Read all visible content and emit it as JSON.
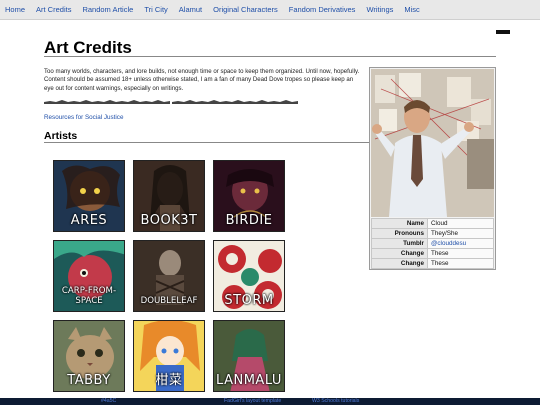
{
  "nav": {
    "items": [
      "Home",
      "Art Credits",
      "Random Article",
      "Tri City",
      "Alamut",
      "Original Characters",
      "Fandom Derivatives",
      "Writings",
      "Misc"
    ]
  },
  "page": {
    "title": "Art Credits",
    "intro": "Too many worlds, characters, and lore builds, not enough time or space to keep them organized. Until now, hopefully. Content should be assumed 18+ unless otherwise stated, I am a fan of many Dead Dove tropes so please keep an eye out for content warnings, especially on writings.",
    "resources_link": "Resources for Social Justice",
    "artists_heading": "Artists"
  },
  "artists": [
    {
      "name": "ARES",
      "bg": "#1f3550",
      "fg": "#8a5a3a"
    },
    {
      "name": "BOOK3T",
      "bg": "#3a2a22",
      "fg": "#8b6a52"
    },
    {
      "name": "BIRDIE",
      "bg": "#2a0f1c",
      "fg": "#6b2a3a"
    },
    {
      "name": "CARP-FROM-SPACE",
      "bg": "#1d5a58",
      "fg": "#c23a4a"
    },
    {
      "name": "DOUBLELEAF",
      "bg": "#3b2f26",
      "fg": "#9a8a7a"
    },
    {
      "name": "STORM",
      "bg": "#f1ece0",
      "fg": "#c32a30"
    },
    {
      "name": "TABBY",
      "bg": "#6d7a5a",
      "fg": "#b59a74"
    },
    {
      "name": "柑菜",
      "bg": "#f4d55a",
      "fg": "#e88a2a"
    },
    {
      "name": "LANMALU",
      "bg": "#4a5a3a",
      "fg": "#b54a6a"
    }
  ],
  "infobox": {
    "rows": [
      {
        "key": "Name",
        "value": "Cloud"
      },
      {
        "key": "Pronouns",
        "value": "They/She"
      },
      {
        "key": "Tumblr",
        "value": "@clouddesu"
      },
      {
        "key": "Change",
        "value": "These"
      },
      {
        "key": "Change",
        "value": "These"
      }
    ]
  },
  "footer": {
    "links": [
      "#4a5C",
      "FadGirl's layout template",
      "W3 Schools tutorials"
    ]
  },
  "colors": {
    "link": "#1f4fa8",
    "nav_bg": "#e8e8e8",
    "footer_bg": "#0d1b33"
  }
}
